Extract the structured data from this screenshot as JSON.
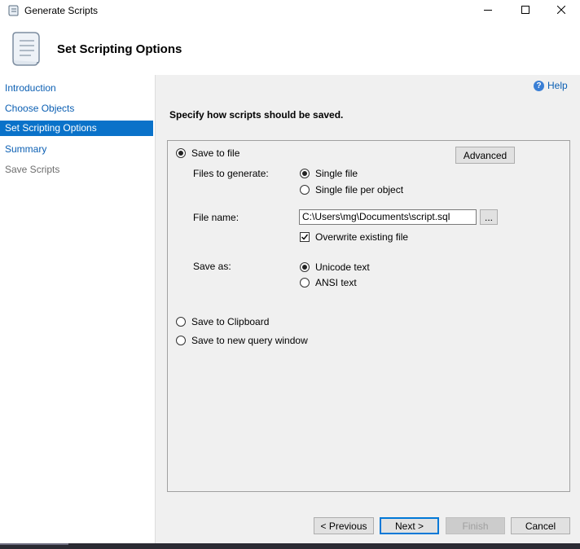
{
  "window": {
    "title": "Generate Scripts",
    "icons": {
      "app": "script-scroll-icon",
      "minimize": "minimize-icon",
      "maximize": "maximize-icon",
      "close": "close-icon"
    }
  },
  "header": {
    "title": "Set Scripting Options",
    "icon": "script-scroll-icon"
  },
  "nav": {
    "items": [
      {
        "label": "Introduction",
        "state": "link"
      },
      {
        "label": "Choose Objects",
        "state": "link"
      },
      {
        "label": "Set Scripting Options",
        "state": "active"
      },
      {
        "label": "Summary",
        "state": "link"
      },
      {
        "label": "Save Scripts",
        "state": "disabled"
      }
    ]
  },
  "main": {
    "help_label": "Help",
    "help_icon": "help-icon",
    "section_title": "Specify how scripts should be saved.",
    "save_to_file": {
      "label": "Save to file",
      "selected": true
    },
    "advanced_label": "Advanced",
    "files_to_generate": {
      "label": "Files to generate:",
      "options": [
        {
          "label": "Single file",
          "selected": true
        },
        {
          "label": "Single file per object",
          "selected": false
        }
      ]
    },
    "file_name": {
      "label": "File name:",
      "value": "C:\\Users\\mg\\Documents\\script.sql",
      "browse_label": "..."
    },
    "overwrite": {
      "label": "Overwrite existing file",
      "checked": true
    },
    "save_as": {
      "label": "Save as:",
      "options": [
        {
          "label": "Unicode text",
          "selected": true
        },
        {
          "label": "ANSI text",
          "selected": false
        }
      ]
    },
    "save_to_clipboard": {
      "label": "Save to Clipboard",
      "selected": false
    },
    "save_to_query": {
      "label": "Save to new query window",
      "selected": false
    }
  },
  "footer": {
    "previous_label": "< Previous",
    "next_label": "Next >",
    "finish_label": "Finish",
    "cancel_label": "Cancel"
  },
  "colors": {
    "accent": "#0a72c9",
    "link": "#0b5fb3",
    "panel": "#f0f0f0"
  }
}
